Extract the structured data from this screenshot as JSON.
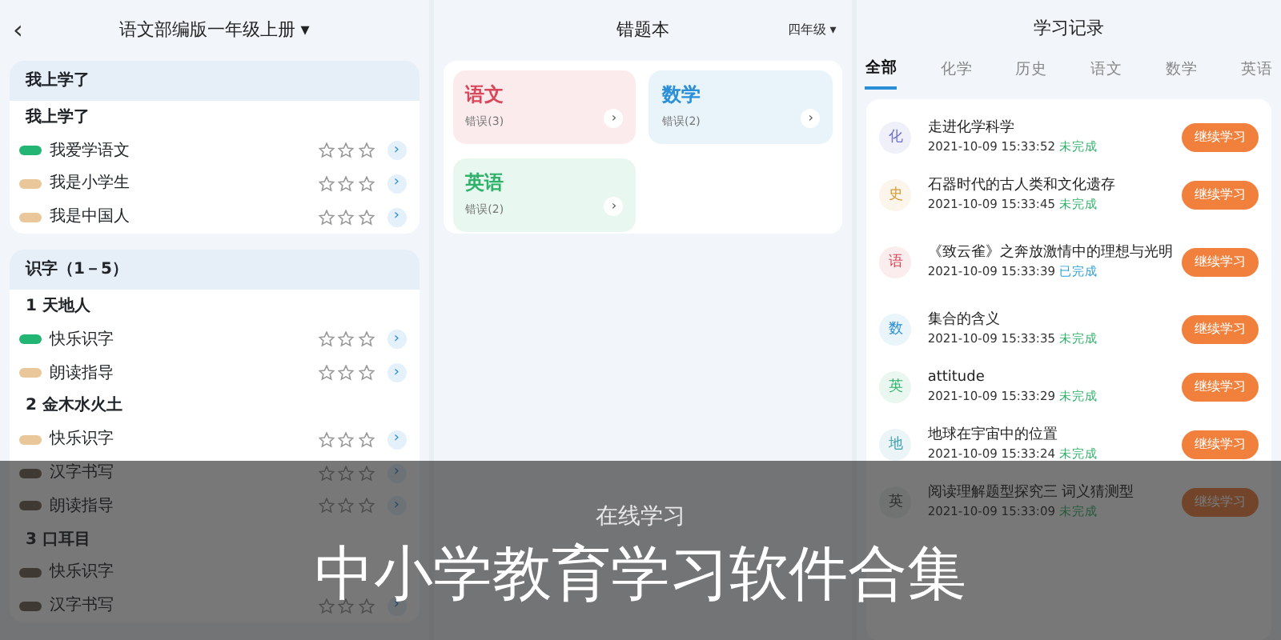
{
  "left_screen": {
    "title": "语文部编版一年级上册",
    "dropdown_caret": "▾",
    "back": "‹",
    "sections": [
      {
        "title": "我上学了",
        "rows": [
          {
            "kind": "heading",
            "label": "我上学了"
          },
          {
            "kind": "lesson",
            "label": "我爱学语文",
            "color": "#22b573",
            "stars": 0,
            "arrow": "›"
          },
          {
            "kind": "lesson",
            "label": "我是小学生",
            "color": "#e9c79a",
            "stars": 0,
            "arrow": "›"
          },
          {
            "kind": "lesson",
            "label": "我是中国人",
            "color": "#e9c79a",
            "stars": 0,
            "arrow": "›"
          }
        ]
      },
      {
        "title": "识字（1－5）",
        "rows": [
          {
            "kind": "heading",
            "label": "1 天地人"
          },
          {
            "kind": "lesson",
            "label": "快乐识字",
            "color": "#22b573",
            "stars": 0,
            "arrow": "›"
          },
          {
            "kind": "lesson",
            "label": "朗读指导",
            "color": "#e9c79a",
            "stars": 0,
            "arrow": "›"
          },
          {
            "kind": "heading",
            "label": "2 金木水火土"
          },
          {
            "kind": "lesson",
            "label": "快乐识字",
            "color": "#e9c79a",
            "stars": 0,
            "arrow": "›"
          },
          {
            "kind": "lesson",
            "label": "汉字书写",
            "color": "#6f6250",
            "stars": 0,
            "arrow": "›"
          },
          {
            "kind": "lesson",
            "label": "朗读指导",
            "color": "#6f6250",
            "stars": 0,
            "arrow": "›"
          },
          {
            "kind": "heading",
            "label": "3 口耳目"
          },
          {
            "kind": "lesson",
            "label": "快乐识字",
            "color": "#6f6250"
          },
          {
            "kind": "lesson",
            "label": "汉字书写",
            "color": "#6f6250",
            "stars": 0,
            "arrow": "›"
          }
        ]
      }
    ]
  },
  "middle_screen": {
    "title": "错题本",
    "grade": "四年级",
    "grade_caret": "▾",
    "cards": [
      {
        "subject": "语文",
        "count": "错误(3)",
        "color": "#d9475a",
        "arrow": "›"
      },
      {
        "subject": "数学",
        "count": "错误(2)",
        "color": "#2a8fd6",
        "arrow": "›"
      },
      {
        "subject": "英语",
        "count": "错误(2)",
        "color": "#2fb36a",
        "arrow": "›"
      }
    ]
  },
  "right_screen": {
    "title": "学习记录",
    "tabs": [
      {
        "label": "全部",
        "selected": true
      },
      {
        "label": "化学",
        "selected": false
      },
      {
        "label": "历史",
        "selected": false
      },
      {
        "label": "语文",
        "selected": false
      },
      {
        "label": "数学",
        "selected": false
      },
      {
        "label": "英语",
        "selected": false
      }
    ],
    "records": [
      {
        "avatar": "化",
        "color": "#6b6fd1",
        "title": "走进化学科学",
        "time": "2021-10-09 15:33:52",
        "status": "未完成",
        "completed": false,
        "button": "继续学习"
      },
      {
        "avatar": "史",
        "color": "#d99a3a",
        "title": "石器时代的古人类和文化遗存",
        "time": "2021-10-09 15:33:45",
        "status": "未完成",
        "completed": false,
        "button": "继续学习"
      },
      {
        "avatar": "语",
        "color": "#d9475a",
        "title": "《致云雀》之奔放激情中的理想与光明",
        "time": "2021-10-09 15:33:39",
        "status": "已完成",
        "completed": true,
        "button": "继续学习"
      },
      {
        "avatar": "数",
        "color": "#2a8fd6",
        "title": "集合的含义",
        "time": "2021-10-09 15:33:35",
        "status": "未完成",
        "completed": false,
        "button": "继续学习"
      },
      {
        "avatar": "英",
        "color": "#2fb36a",
        "title": "attitude",
        "time": "2021-10-09 15:33:29",
        "status": "未完成",
        "completed": false,
        "button": "继续学习"
      },
      {
        "avatar": "地",
        "color": "#3a9fae",
        "title": "地球在宇宙中的位置",
        "time": "2021-10-09 15:33:24",
        "status": "未完成",
        "completed": false,
        "button": "继续学习"
      },
      {
        "avatar": "英",
        "title": "阅读理解题型探究三 词义猜测型",
        "time": "2021-10-09 15:33:09",
        "status": "未完成",
        "completed": false,
        "button": "继续学习"
      }
    ]
  },
  "banner": {
    "subtitle": "在线学习",
    "title": "中小学教育学习软件合集"
  }
}
